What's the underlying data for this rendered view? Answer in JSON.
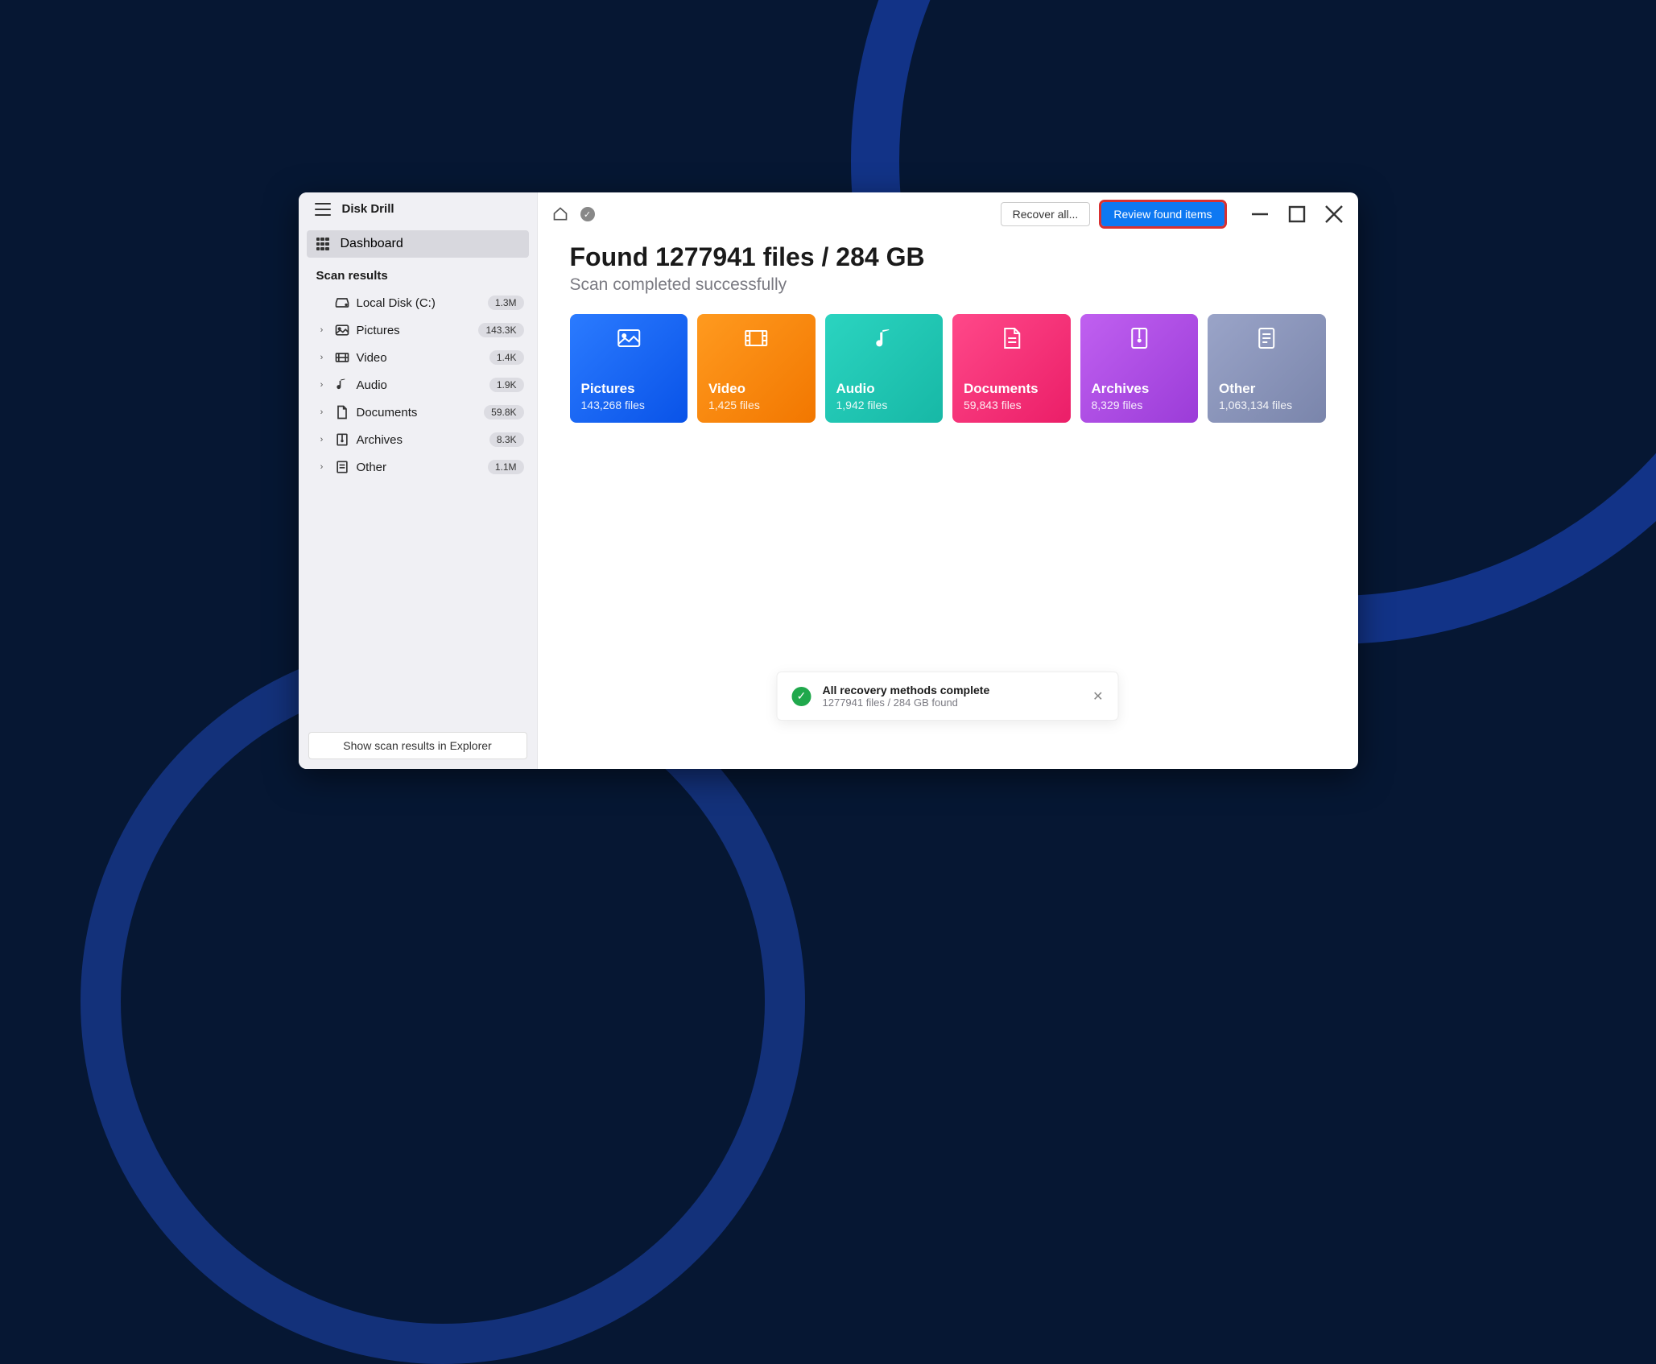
{
  "app": {
    "title": "Disk Drill"
  },
  "sidebar": {
    "dashboard_label": "Dashboard",
    "section_title": "Scan results",
    "items": [
      {
        "label": "Local Disk (C:)",
        "badge": "1.3M",
        "expandable": false
      },
      {
        "label": "Pictures",
        "badge": "143.3K",
        "expandable": true
      },
      {
        "label": "Video",
        "badge": "1.4K",
        "expandable": true
      },
      {
        "label": "Audio",
        "badge": "1.9K",
        "expandable": true
      },
      {
        "label": "Documents",
        "badge": "59.8K",
        "expandable": true
      },
      {
        "label": "Archives",
        "badge": "8.3K",
        "expandable": true
      },
      {
        "label": "Other",
        "badge": "1.1M",
        "expandable": true
      }
    ],
    "footer_button": "Show scan results in Explorer"
  },
  "toolbar": {
    "recover_all_label": "Recover all...",
    "review_label": "Review found items"
  },
  "results": {
    "headline": "Found 1277941 files / 284 GB",
    "subheadline": "Scan completed successfully",
    "cards": [
      {
        "key": "pictures",
        "title": "Pictures",
        "sub": "143,268 files"
      },
      {
        "key": "video",
        "title": "Video",
        "sub": "1,425 files"
      },
      {
        "key": "audio",
        "title": "Audio",
        "sub": "1,942 files"
      },
      {
        "key": "documents",
        "title": "Documents",
        "sub": "59,843 files"
      },
      {
        "key": "archives",
        "title": "Archives",
        "sub": "8,329 files"
      },
      {
        "key": "other",
        "title": "Other",
        "sub": "1,063,134 files"
      }
    ]
  },
  "toast": {
    "title": "All recovery methods complete",
    "sub": "1277941 files / 284 GB found"
  }
}
